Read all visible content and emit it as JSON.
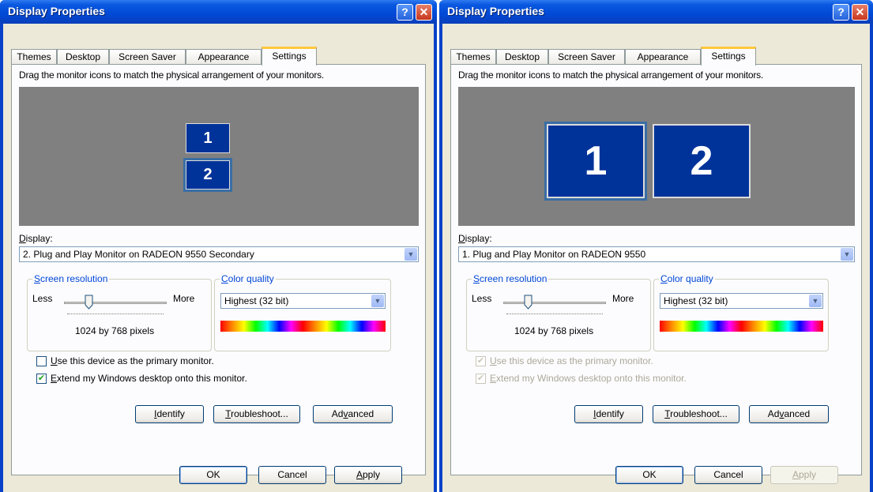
{
  "windows": [
    {
      "title": "Display Properties",
      "tabs": [
        "Themes",
        "Desktop",
        "Screen Saver",
        "Appearance",
        "Settings"
      ],
      "active_tab": "Settings",
      "instruction": "Drag the monitor icons to match the physical arrangement of your monitors.",
      "monitors": [
        "1",
        "2"
      ],
      "selected_monitor": "2",
      "display_label": "Display:",
      "display_value": "2. Plug and Play Monitor on RADEON 9550 Secondary",
      "resolution_group": "Screen resolution",
      "less": "Less",
      "more": "More",
      "resolution_value": "1024 by 768 pixels",
      "color_group": "Color quality",
      "color_value": "Highest (32 bit)",
      "primary_checkbox": {
        "label": "Use this device as the primary monitor.",
        "checked": false,
        "enabled": true
      },
      "extend_checkbox": {
        "label": "Extend my Windows desktop onto this monitor.",
        "checked": true,
        "enabled": true
      },
      "buttons": {
        "identify": "Identify",
        "troubleshoot": "Troubleshoot...",
        "advanced": "Advanced"
      },
      "footer": {
        "ok": "OK",
        "cancel": "Cancel",
        "apply": "Apply",
        "apply_enabled": true
      }
    },
    {
      "title": "Display Properties",
      "tabs": [
        "Themes",
        "Desktop",
        "Screen Saver",
        "Appearance",
        "Settings"
      ],
      "active_tab": "Settings",
      "instruction": "Drag the monitor icons to match the physical arrangement of your monitors.",
      "monitors": [
        "1",
        "2"
      ],
      "selected_monitor": "1",
      "display_label": "Display:",
      "display_value": "1. Plug and Play Monitor on RADEON 9550",
      "resolution_group": "Screen resolution",
      "less": "Less",
      "more": "More",
      "resolution_value": "1024 by 768 pixels",
      "color_group": "Color quality",
      "color_value": "Highest (32 bit)",
      "primary_checkbox": {
        "label": "Use this device as the primary monitor.",
        "checked": true,
        "enabled": false
      },
      "extend_checkbox": {
        "label": "Extend my Windows desktop onto this monitor.",
        "checked": true,
        "enabled": false
      },
      "buttons": {
        "identify": "Identify",
        "troubleshoot": "Troubleshoot...",
        "advanced": "Advanced"
      },
      "footer": {
        "ok": "OK",
        "cancel": "Cancel",
        "apply": "Apply",
        "apply_enabled": false
      }
    }
  ],
  "icons": {
    "help": "question-mark-icon",
    "close": "close-x-icon",
    "dropdown": "chevron-down-icon",
    "slider": "slider-thumb-icon",
    "check": "checkmark-icon"
  },
  "colors": {
    "title_bar": "#0a58e0",
    "dialog_bg": "#ece9d8",
    "monitor_fill": "#003399",
    "monitor_area": "#808080",
    "tab_highlight": "#ffc83c"
  }
}
